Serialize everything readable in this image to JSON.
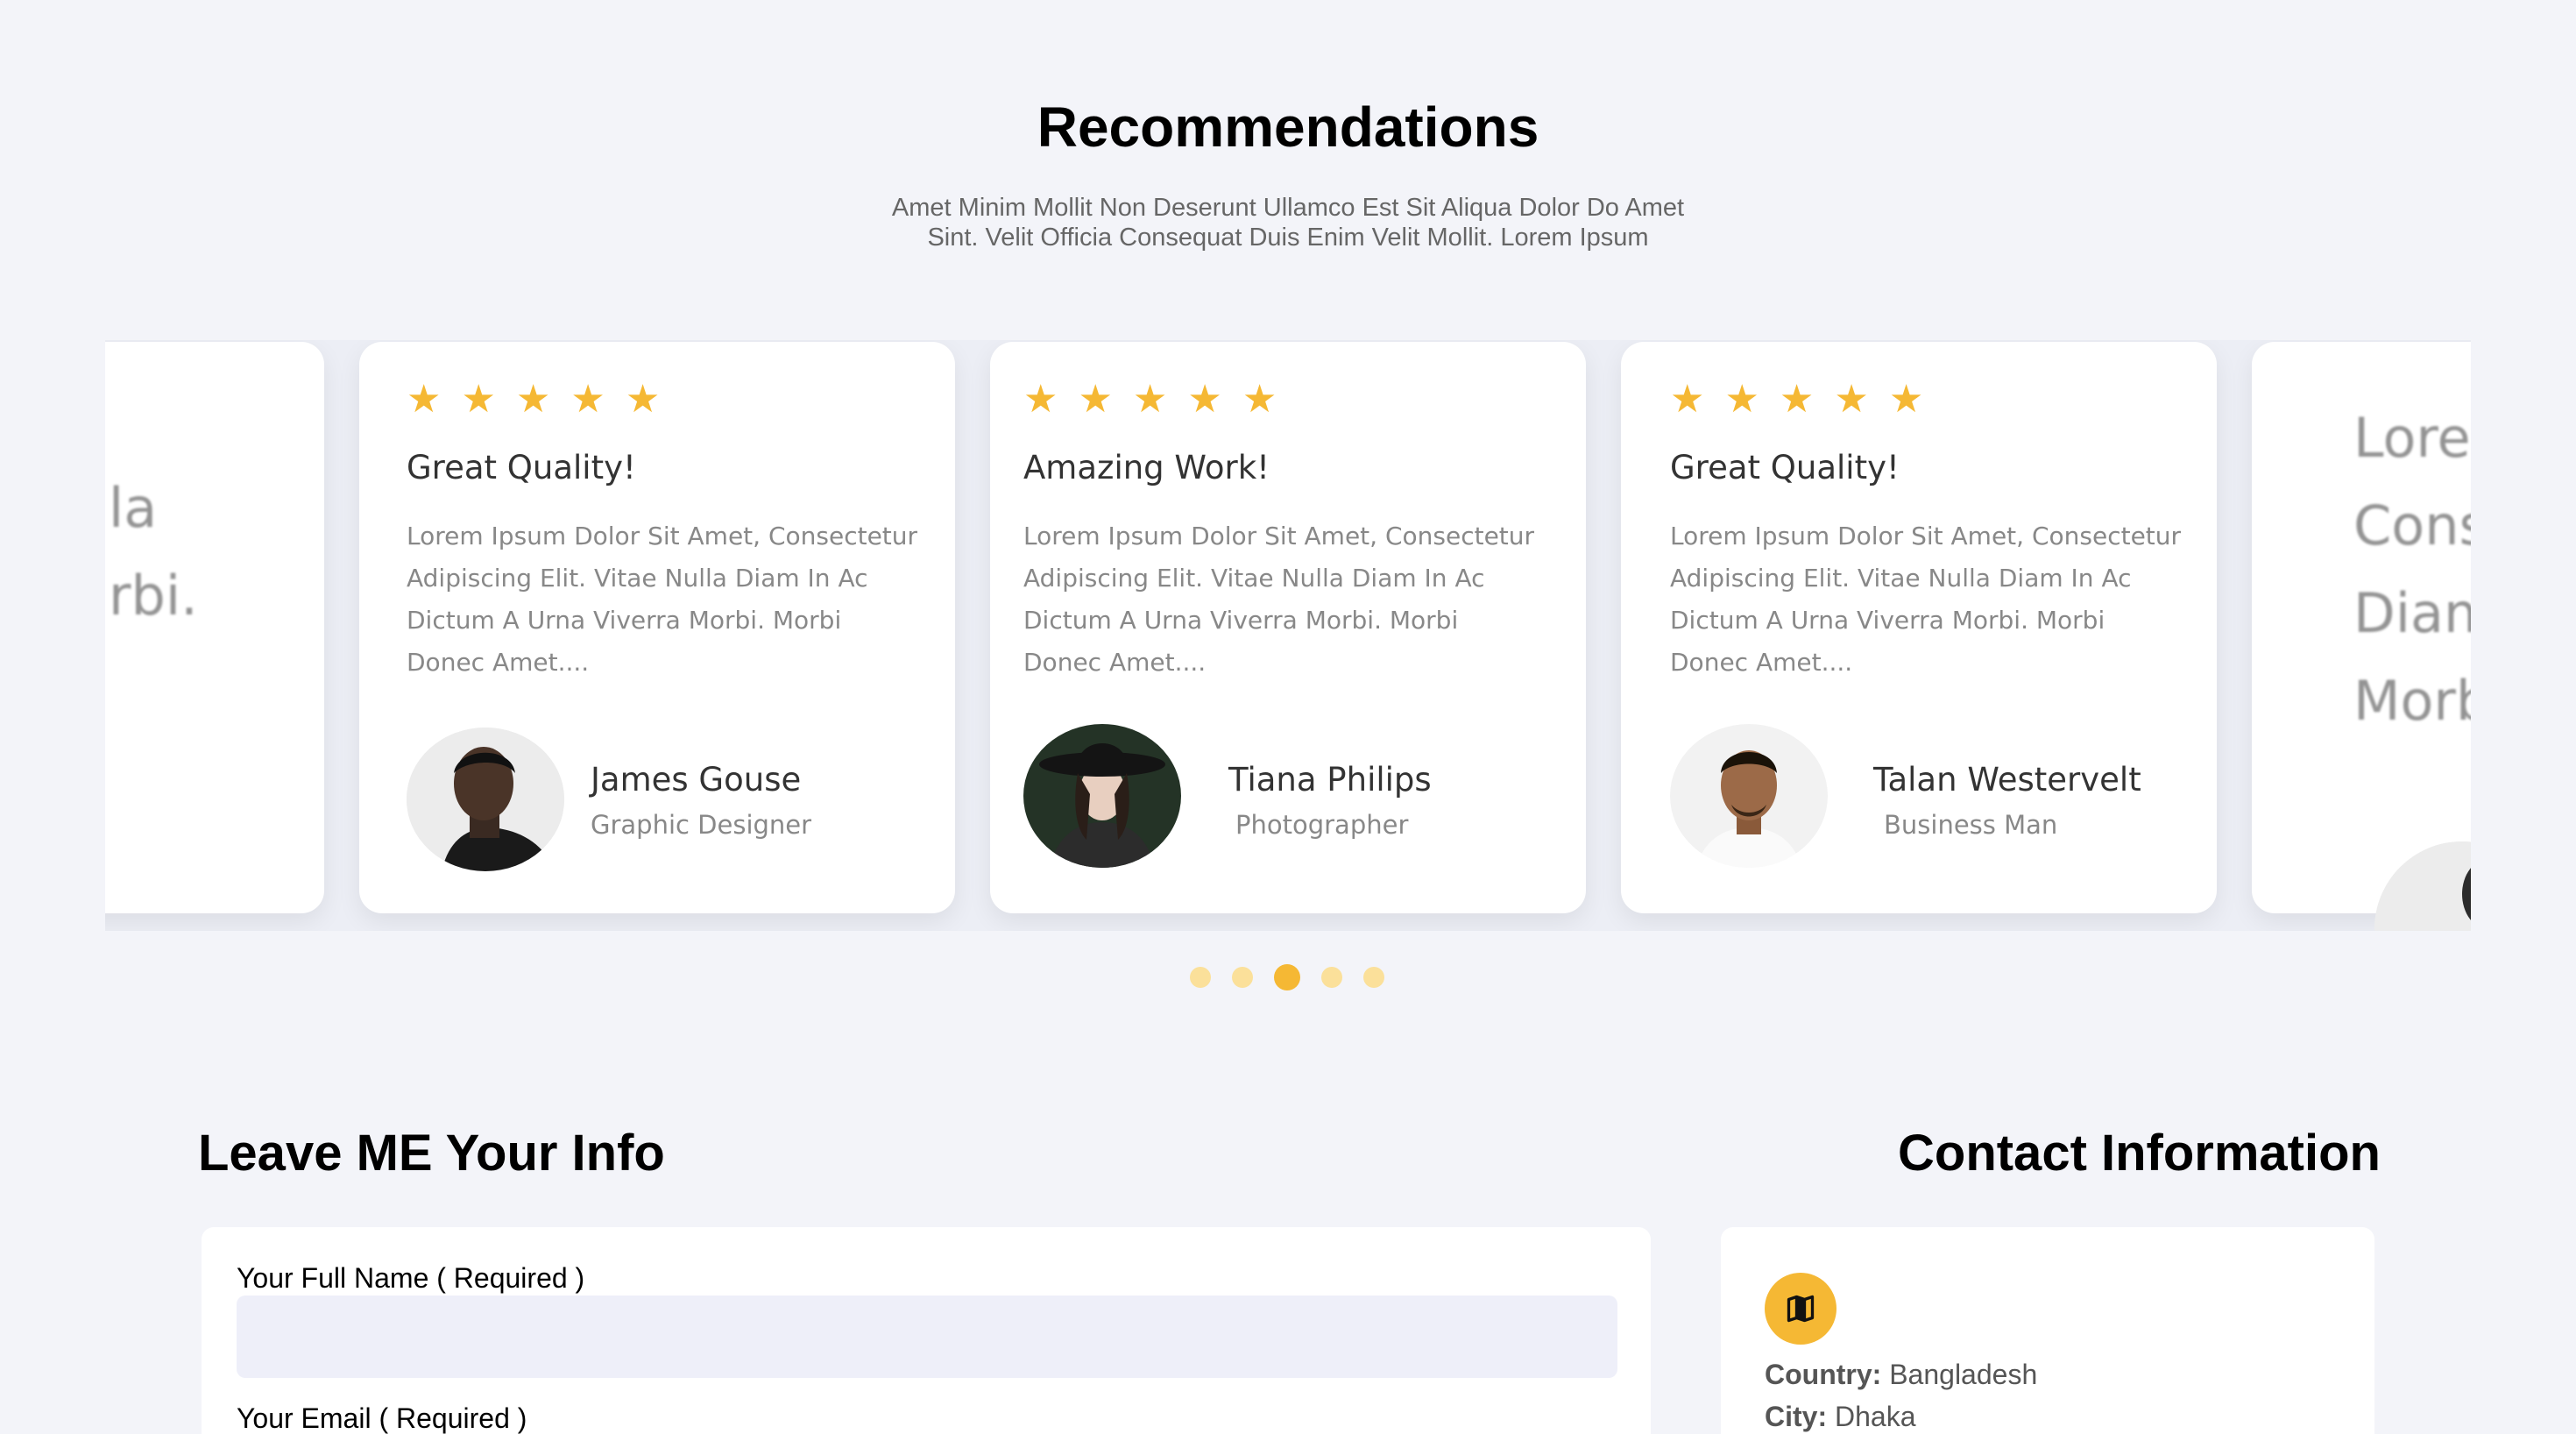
{
  "recommendations": {
    "title": "Recommendations",
    "subtitle_line1": "Amet Minim Mollit Non Deserunt Ullamco Est Sit Aliqua Dolor Do Amet",
    "subtitle_line2": "Sint. Velit Officia Consequat Duis Enim Velit Mollit. Lorem Ipsum"
  },
  "ghost_left": {
    "line1": "la",
    "line2": "rbi."
  },
  "ghost_right": {
    "line1": "Lore",
    "line2": "Cons",
    "line3": "Diam",
    "line4": "Morb"
  },
  "cards": [
    {
      "rating": 5,
      "stars": [
        "★",
        "★",
        "★",
        "★",
        "★"
      ],
      "title": "Great Quality!",
      "body": "Lorem Ipsum Dolor Sit Amet, Consectetur Adipiscing Elit. Vitae Nulla Diam In Ac Dictum A Urna Viverra Morbi. Morbi Donec Amet....",
      "name": "James Gouse",
      "role": "Graphic Designer"
    },
    {
      "rating": 5,
      "stars": [
        "★",
        "★",
        "★",
        "★",
        "★"
      ],
      "title": "Amazing Work!",
      "body": "Lorem Ipsum Dolor Sit Amet, Consectetur Adipiscing Elit. Vitae Nulla Diam In Ac Dictum A Urna Viverra Morbi. Morbi Donec Amet....",
      "name": "Tiana Philips",
      "role": "Photographer"
    },
    {
      "rating": 5,
      "stars": [
        "★",
        "★",
        "★",
        "★",
        "★"
      ],
      "title": "Great Quality!",
      "body": "Lorem Ipsum Dolor Sit Amet, Consectetur Adipiscing Elit. Vitae Nulla Diam In Ac Dictum A Urna Viverra Morbi. Morbi Donec Amet....",
      "name": "Talan Westervelt",
      "role": "Business Man"
    }
  ],
  "carousel": {
    "slide_count": 5,
    "active_index": 2
  },
  "form": {
    "title": "Leave ME Your Info",
    "fullname_label": "Your Full Name ( Required )",
    "email_label": "Your Email ( Required )"
  },
  "contact": {
    "title": "Contact Information",
    "icon": "map-icon",
    "country_label": "Country:",
    "country_value": "Bangladesh",
    "city_label": "City:",
    "city_value": "Dhaka"
  },
  "colors": {
    "accent": "#f5b834",
    "accent_light": "#fbe09a",
    "background": "#f3f4f9",
    "input_bg": "#eeeff9"
  }
}
